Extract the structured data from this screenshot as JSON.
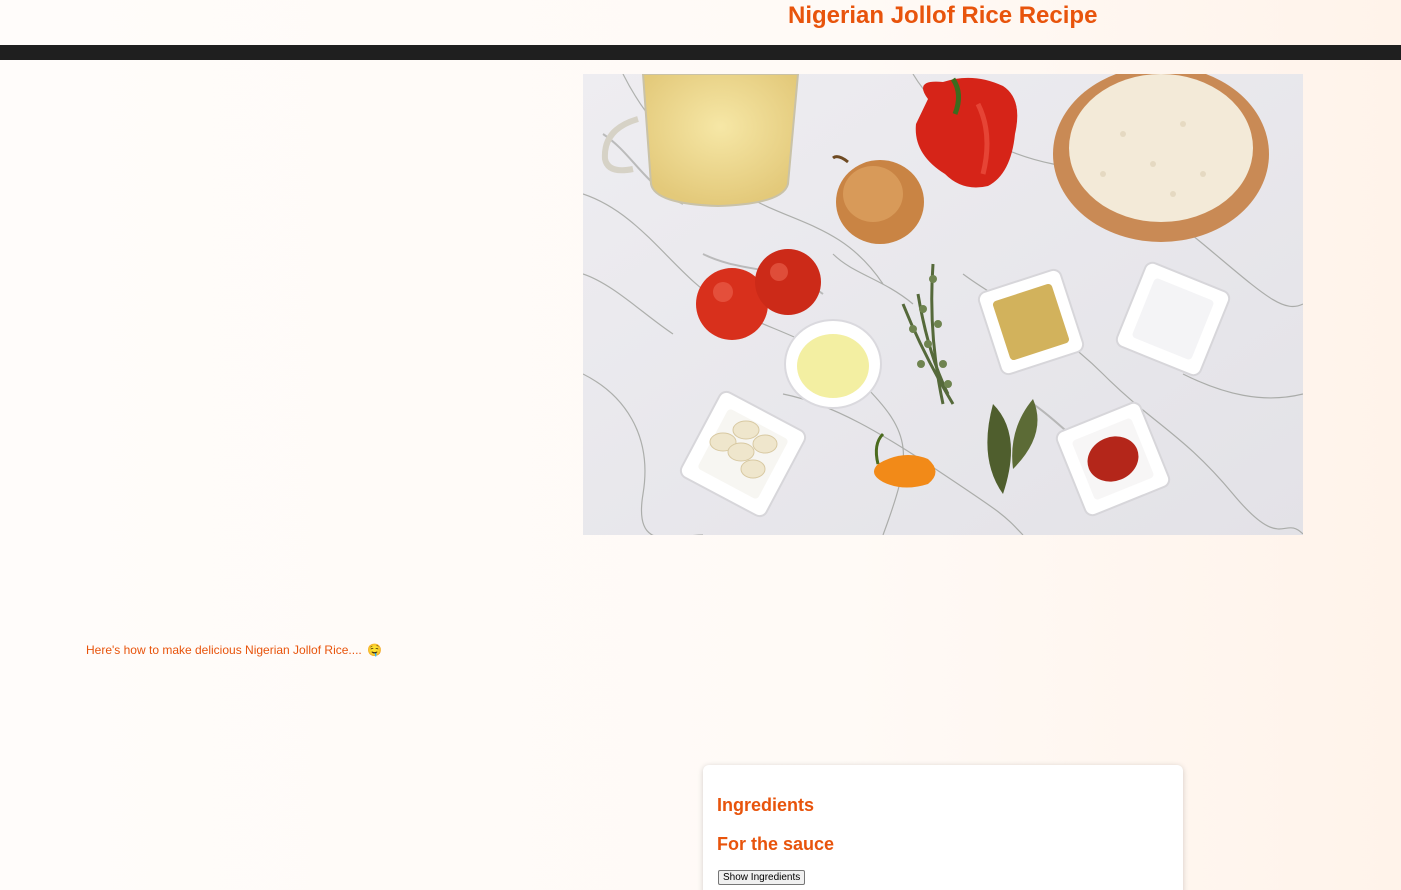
{
  "header": {
    "title": "Nigerian Jollof Rice Recipe"
  },
  "hero": {
    "alt": "Jollof rice ingredients on marble: stock, peppers, onion, rice, tomatoes, oil, thyme, spices, garlic, scotch bonnet, bay leaves, tomato paste"
  },
  "intro": {
    "text": "Here's how to make delicious Nigerian Jollof Rice....",
    "emoji": "🤤"
  },
  "ingredients_card": {
    "heading": "Ingredients",
    "subheading": "For the sauce",
    "button_label": "Show Ingredients"
  },
  "colors": {
    "accent": "#e8540c",
    "nav": "#1f1f1f"
  }
}
